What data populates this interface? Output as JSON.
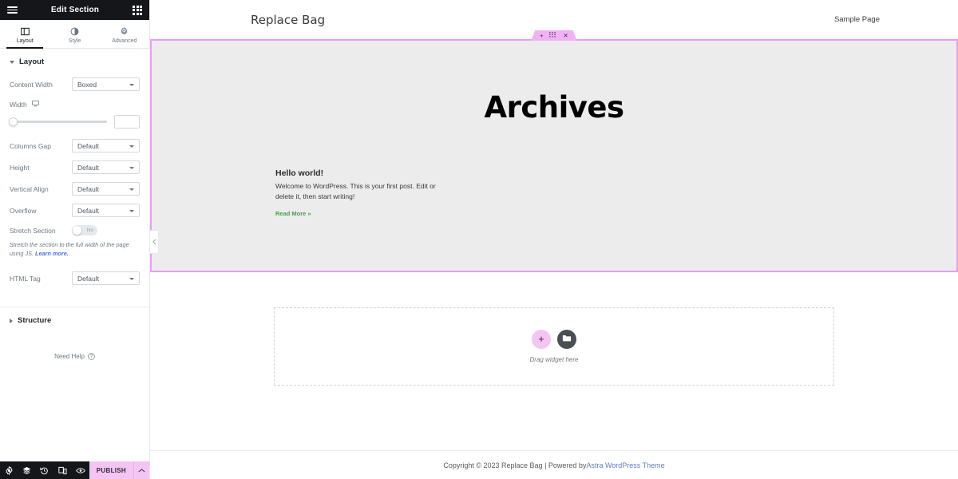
{
  "panel": {
    "header": {
      "title": "Edit Section",
      "menu_icon": "hamburger-icon",
      "apps_icon": "apps-grid-icon"
    },
    "tabs": [
      {
        "label": "Layout",
        "icon": "layout-columns-icon",
        "active": true
      },
      {
        "label": "Style",
        "icon": "contrast-circle-icon",
        "active": false
      },
      {
        "label": "Advanced",
        "icon": "gear-icon",
        "active": false
      }
    ],
    "layout_section": {
      "title": "Layout",
      "expanded": true,
      "controls": {
        "content_width": {
          "label": "Content Width",
          "value": "Boxed"
        },
        "width": {
          "label": "Width",
          "device_icon": "desktop-icon",
          "slider_value": 0,
          "input_value": ""
        },
        "columns_gap": {
          "label": "Columns Gap",
          "value": "Default"
        },
        "height": {
          "label": "Height",
          "value": "Default"
        },
        "vertical_align": {
          "label": "Vertical Align",
          "value": "Default"
        },
        "overflow": {
          "label": "Overflow",
          "value": "Default"
        },
        "stretch_section": {
          "label": "Stretch Section",
          "toggle_state": "No",
          "helper_text": "Stretch the section to the full width of the page using JS.",
          "helper_link": "Learn more."
        },
        "html_tag": {
          "label": "HTML Tag",
          "value": "Default"
        }
      }
    },
    "structure_section": {
      "title": "Structure",
      "expanded": false
    },
    "need_help": {
      "label": "Need Help",
      "icon": "question-circle-icon"
    },
    "footer": {
      "icons": [
        "settings-gear-icon",
        "navigator-layers-icon",
        "history-revisions-icon",
        "responsive-mode-icon",
        "preview-eye-icon"
      ],
      "publish_label": "PUBLISH",
      "publish_chevron": "chevron-up-icon"
    },
    "collapse_handle_icon": "chevron-left-icon"
  },
  "preview": {
    "site_title": "Replace Bag",
    "nav": [
      {
        "label": "Sample Page"
      }
    ],
    "section_toolbar": [
      {
        "icon": "plus-icon",
        "glyph": "+"
      },
      {
        "icon": "drag-handle-icon",
        "glyph": "⦀"
      },
      {
        "icon": "close-icon",
        "glyph": "✕"
      }
    ],
    "page_heading": "Archives",
    "post": {
      "title": "Hello world!",
      "excerpt": "Welcome to WordPress. This is your first post. Edit or delete it, then start writing!",
      "read_more": "Read More »"
    },
    "drop_area": {
      "add_icon": "plus-icon",
      "template_icon": "folder-template-icon",
      "label": "Drag widget here"
    },
    "footer": {
      "text": "Copyright © 2023 Replace Bag | Powered by ",
      "link": "Astra WordPress Theme"
    }
  },
  "colors": {
    "panel_dark": "#14161a",
    "accent_pink": "#f4c4f3",
    "section_border": "#e8a0f0",
    "read_more_green": "#45a049",
    "footer_link_blue": "#5b7fc4",
    "section_bg": "#ececec"
  }
}
